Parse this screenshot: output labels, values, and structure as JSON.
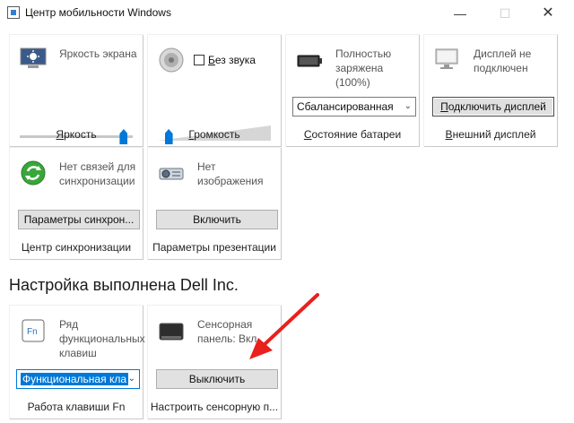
{
  "window": {
    "title": "Центр мобильности Windows",
    "controls": {
      "minimize": "—",
      "maximize": "☐",
      "close": "✕"
    }
  },
  "tiles": {
    "brightness": {
      "label": "Яркость экрана",
      "caption_u": "Я",
      "caption_rest": "ркость",
      "level": 0.92
    },
    "volume": {
      "mute_label_u": "Б",
      "mute_label_rest": "ез звука",
      "muted": false,
      "caption_u": "Г",
      "caption_rest": "ромкость",
      "level": 0.08
    },
    "battery": {
      "status": "Полностью заряжена (100%)",
      "plan": "Сбалансированная",
      "caption_u": "С",
      "caption_rest": "остояние батареи"
    },
    "display": {
      "status": "Дисплей не подключен",
      "button_u": "П",
      "button_rest": "одключить дисплей",
      "caption_u": "В",
      "caption_rest": "нешний дисплей"
    },
    "sync": {
      "status": "Нет связей для синхронизации",
      "button": "Параметры синхрон...",
      "caption": "Центр синхронизации"
    },
    "presentation": {
      "status": "Нет изображения",
      "button": "Включить",
      "caption": "Параметры презентации"
    }
  },
  "oem": {
    "section_title": "Настройка выполнена Dell Inc.",
    "fn_row": {
      "status": "Ряд функциональных клавиш",
      "selected": "Функциональная кла",
      "caption": "Работа клавиши Fn",
      "icon_text": "Fn"
    },
    "touchpad": {
      "status": "Сенсорная панель: Вкл",
      "button": "Выключить",
      "caption": "Настроить сенсорную п..."
    }
  },
  "colors": {
    "accent": "#0078d7",
    "arrow": "#e8211c"
  }
}
